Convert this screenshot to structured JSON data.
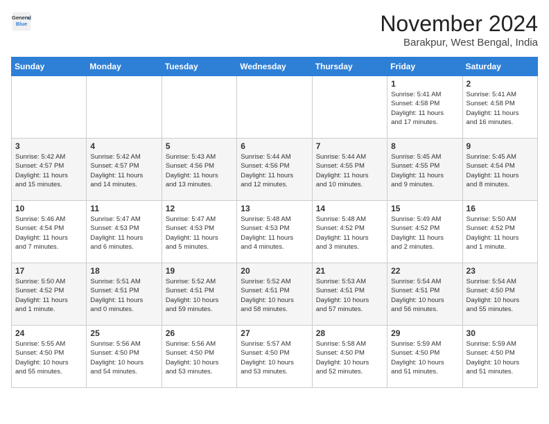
{
  "header": {
    "logo_line1": "General",
    "logo_line2": "Blue",
    "month": "November 2024",
    "location": "Barakpur, West Bengal, India"
  },
  "weekdays": [
    "Sunday",
    "Monday",
    "Tuesday",
    "Wednesday",
    "Thursday",
    "Friday",
    "Saturday"
  ],
  "weeks": [
    [
      {
        "day": "",
        "content": ""
      },
      {
        "day": "",
        "content": ""
      },
      {
        "day": "",
        "content": ""
      },
      {
        "day": "",
        "content": ""
      },
      {
        "day": "",
        "content": ""
      },
      {
        "day": "1",
        "content": "Sunrise: 5:41 AM\nSunset: 4:58 PM\nDaylight: 11 hours\nand 17 minutes."
      },
      {
        "day": "2",
        "content": "Sunrise: 5:41 AM\nSunset: 4:58 PM\nDaylight: 11 hours\nand 16 minutes."
      }
    ],
    [
      {
        "day": "3",
        "content": "Sunrise: 5:42 AM\nSunset: 4:57 PM\nDaylight: 11 hours\nand 15 minutes."
      },
      {
        "day": "4",
        "content": "Sunrise: 5:42 AM\nSunset: 4:57 PM\nDaylight: 11 hours\nand 14 minutes."
      },
      {
        "day": "5",
        "content": "Sunrise: 5:43 AM\nSunset: 4:56 PM\nDaylight: 11 hours\nand 13 minutes."
      },
      {
        "day": "6",
        "content": "Sunrise: 5:44 AM\nSunset: 4:56 PM\nDaylight: 11 hours\nand 12 minutes."
      },
      {
        "day": "7",
        "content": "Sunrise: 5:44 AM\nSunset: 4:55 PM\nDaylight: 11 hours\nand 10 minutes."
      },
      {
        "day": "8",
        "content": "Sunrise: 5:45 AM\nSunset: 4:55 PM\nDaylight: 11 hours\nand 9 minutes."
      },
      {
        "day": "9",
        "content": "Sunrise: 5:45 AM\nSunset: 4:54 PM\nDaylight: 11 hours\nand 8 minutes."
      }
    ],
    [
      {
        "day": "10",
        "content": "Sunrise: 5:46 AM\nSunset: 4:54 PM\nDaylight: 11 hours\nand 7 minutes."
      },
      {
        "day": "11",
        "content": "Sunrise: 5:47 AM\nSunset: 4:53 PM\nDaylight: 11 hours\nand 6 minutes."
      },
      {
        "day": "12",
        "content": "Sunrise: 5:47 AM\nSunset: 4:53 PM\nDaylight: 11 hours\nand 5 minutes."
      },
      {
        "day": "13",
        "content": "Sunrise: 5:48 AM\nSunset: 4:53 PM\nDaylight: 11 hours\nand 4 minutes."
      },
      {
        "day": "14",
        "content": "Sunrise: 5:48 AM\nSunset: 4:52 PM\nDaylight: 11 hours\nand 3 minutes."
      },
      {
        "day": "15",
        "content": "Sunrise: 5:49 AM\nSunset: 4:52 PM\nDaylight: 11 hours\nand 2 minutes."
      },
      {
        "day": "16",
        "content": "Sunrise: 5:50 AM\nSunset: 4:52 PM\nDaylight: 11 hours\nand 1 minute."
      }
    ],
    [
      {
        "day": "17",
        "content": "Sunrise: 5:50 AM\nSunset: 4:52 PM\nDaylight: 11 hours\nand 1 minute."
      },
      {
        "day": "18",
        "content": "Sunrise: 5:51 AM\nSunset: 4:51 PM\nDaylight: 11 hours\nand 0 minutes."
      },
      {
        "day": "19",
        "content": "Sunrise: 5:52 AM\nSunset: 4:51 PM\nDaylight: 10 hours\nand 59 minutes."
      },
      {
        "day": "20",
        "content": "Sunrise: 5:52 AM\nSunset: 4:51 PM\nDaylight: 10 hours\nand 58 minutes."
      },
      {
        "day": "21",
        "content": "Sunrise: 5:53 AM\nSunset: 4:51 PM\nDaylight: 10 hours\nand 57 minutes."
      },
      {
        "day": "22",
        "content": "Sunrise: 5:54 AM\nSunset: 4:51 PM\nDaylight: 10 hours\nand 56 minutes."
      },
      {
        "day": "23",
        "content": "Sunrise: 5:54 AM\nSunset: 4:50 PM\nDaylight: 10 hours\nand 55 minutes."
      }
    ],
    [
      {
        "day": "24",
        "content": "Sunrise: 5:55 AM\nSunset: 4:50 PM\nDaylight: 10 hours\nand 55 minutes."
      },
      {
        "day": "25",
        "content": "Sunrise: 5:56 AM\nSunset: 4:50 PM\nDaylight: 10 hours\nand 54 minutes."
      },
      {
        "day": "26",
        "content": "Sunrise: 5:56 AM\nSunset: 4:50 PM\nDaylight: 10 hours\nand 53 minutes."
      },
      {
        "day": "27",
        "content": "Sunrise: 5:57 AM\nSunset: 4:50 PM\nDaylight: 10 hours\nand 53 minutes."
      },
      {
        "day": "28",
        "content": "Sunrise: 5:58 AM\nSunset: 4:50 PM\nDaylight: 10 hours\nand 52 minutes."
      },
      {
        "day": "29",
        "content": "Sunrise: 5:59 AM\nSunset: 4:50 PM\nDaylight: 10 hours\nand 51 minutes."
      },
      {
        "day": "30",
        "content": "Sunrise: 5:59 AM\nSunset: 4:50 PM\nDaylight: 10 hours\nand 51 minutes."
      }
    ]
  ]
}
